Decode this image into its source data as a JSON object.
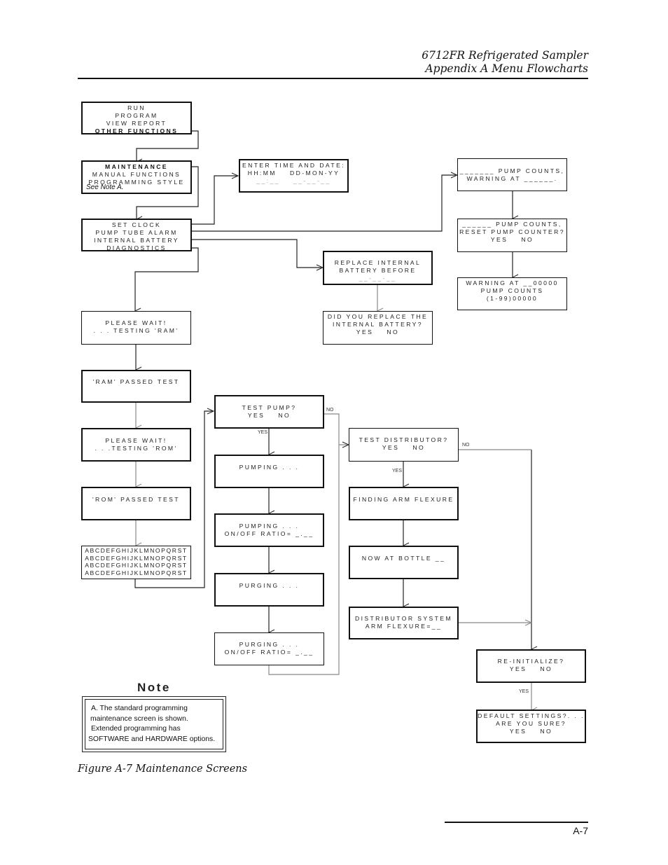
{
  "header": {
    "line1": "6712FR Refrigerated Sampler",
    "line2": "Appendix A  Menu Flowcharts"
  },
  "flowchart": {
    "main_menu": {
      "lines": [
        "RUN",
        "PROGRAM",
        "VIEW REPORT",
        "OTHER FUNCTIONS"
      ],
      "selected": "OTHER FUNCTIONS"
    },
    "other_functions": {
      "lines": [
        "MAINTENANCE",
        "MANUAL FUNCTIONS",
        "PROGRAMMING STYLE"
      ],
      "selected": "MAINTENANCE",
      "note_ref": "See Note A."
    },
    "maintenance": {
      "lines": [
        "SET CLOCK",
        "PUMP TUBE ALARM",
        "INTERNAL BATTERY",
        "DIAGNOSTICS"
      ]
    },
    "set_clock": {
      "lines": [
        "ENTER TIME AND DATE:",
        "HH:MM    DD-MON-YY",
        "__:__    __-__-__"
      ]
    },
    "pump_counts": {
      "lines": [
        "_______ PUMP COUNTS,",
        "WARNING AT ______."
      ]
    },
    "reset_counter": {
      "lines": [
        "______ PUMP COUNTS,",
        "RESET PUMP COUNTER?",
        "YES    NO"
      ]
    },
    "warning_at": {
      "lines": [
        "WARNING AT __00000",
        "PUMP COUNTS",
        "(1-99)00000"
      ]
    },
    "replace_battery": {
      "lines": [
        "REPLACE INTERNAL",
        "BATTERY BEFORE",
        "__-__-__"
      ]
    },
    "did_replace": {
      "lines": [
        "DID YOU REPLACE THE",
        "INTERNAL BATTERY?",
        "YES    NO"
      ]
    },
    "testing_ram": {
      "lines": [
        "PLEASE WAIT!",
        ". . . TESTING 'RAM'"
      ]
    },
    "ram_passed": {
      "lines": [
        "'RAM' PASSED TEST"
      ]
    },
    "testing_rom": {
      "lines": [
        "PLEASE WAIT!",
        ". . .TESTING 'ROM'"
      ]
    },
    "rom_passed": {
      "lines": [
        "'ROM' PASSED TEST"
      ]
    },
    "display_test": {
      "lines": [
        "ABCDEFGHIJKLMNOPQRST",
        "ABCDEFGHIJKLMNOPQRST",
        "ABCDEFGHIJKLMNOPQRST",
        "ABCDEFGHIJKLMNOPQRST"
      ]
    },
    "test_pump": {
      "lines": [
        "TEST PUMP?",
        "YES    NO"
      ]
    },
    "pumping": {
      "lines": [
        "PUMPING . . ."
      ]
    },
    "pumping_ratio": {
      "lines": [
        "PUMPING . . .",
        "ON/OFF RATIO= _.__"
      ]
    },
    "purging": {
      "lines": [
        "PURGING . . ."
      ]
    },
    "purging_ratio": {
      "lines": [
        "PURGING . . .",
        "ON/OFF RATIO= _.__"
      ]
    },
    "test_distributor": {
      "lines": [
        "TEST DISTRIBUTOR?",
        "YES    NO"
      ]
    },
    "finding_arm": {
      "lines": [
        "FINDING ARM FLEXURE"
      ]
    },
    "now_at_bottle": {
      "lines": [
        "NOW AT BOTTLE __"
      ]
    },
    "arm_flexure": {
      "lines": [
        "DISTRIBUTOR SYSTEM",
        "ARM FLEXURE=__"
      ]
    },
    "reinitialize": {
      "lines": [
        "RE-INITIALIZE?",
        "YES    NO"
      ]
    },
    "default_settings": {
      "lines": [
        "DEFAULT SETTINGS?. . .",
        "ARE YOU SURE?",
        "YES    NO"
      ]
    },
    "labels": {
      "test_pump_no": "NO",
      "test_pump_yes": "YES",
      "test_distributor_no": "NO",
      "test_distributor_yes": "YES",
      "reinitialize_yes": "YES"
    }
  },
  "note": {
    "title": "Note",
    "lines": [
      "A. The standard programming",
      "maintenance screen is shown.",
      "Extended programming has",
      "SOFTWARE and HARDWARE options."
    ]
  },
  "caption": "Figure A-7  Maintenance Screens",
  "footer": {
    "page_number": "A-7"
  }
}
